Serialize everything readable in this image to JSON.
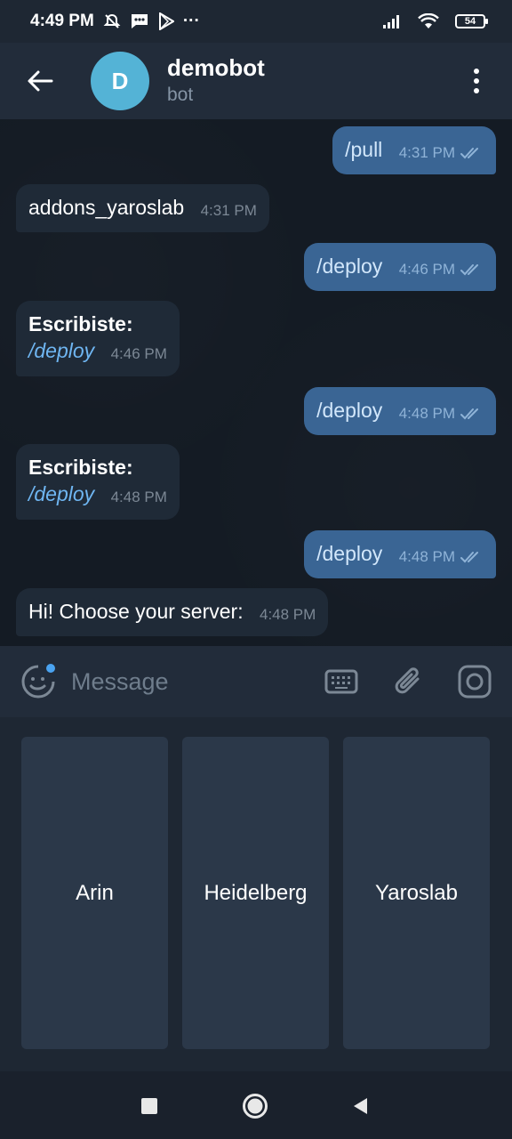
{
  "status_bar": {
    "time": "4:49 PM",
    "overflow": "···",
    "battery": "54"
  },
  "header": {
    "avatar_letter": "D",
    "title": "demobot",
    "subtitle": "bot",
    "avatar_color": "#54b3d6"
  },
  "messages": [
    {
      "direction": "out",
      "text": "/pull",
      "time": "4:31 PM",
      "status": "read"
    },
    {
      "direction": "in",
      "text": "addons_yaroslab",
      "time": "4:31 PM"
    },
    {
      "direction": "out",
      "text": "/deploy",
      "time": "4:46 PM",
      "status": "read"
    },
    {
      "direction": "in",
      "title": "Escribiste:",
      "command": "/deploy",
      "time": "4:46 PM"
    },
    {
      "direction": "out",
      "text": "/deploy",
      "time": "4:48 PM",
      "status": "read"
    },
    {
      "direction": "in",
      "title": "Escribiste:",
      "command": "/deploy",
      "time": "4:48 PM"
    },
    {
      "direction": "out",
      "text": "/deploy",
      "time": "4:48 PM",
      "status": "read"
    },
    {
      "direction": "in",
      "text": "Hi! Choose your server:",
      "time": "4:48 PM"
    }
  ],
  "input": {
    "placeholder": "Message",
    "value": ""
  },
  "keyboard": {
    "buttons": [
      "Arin",
      "Heidelberg",
      "Yaroslab"
    ]
  },
  "colors": {
    "outgoing_bubble": "#3a6594",
    "incoming_bubble": "#1f2a37",
    "accent": "#4aa3f0"
  }
}
